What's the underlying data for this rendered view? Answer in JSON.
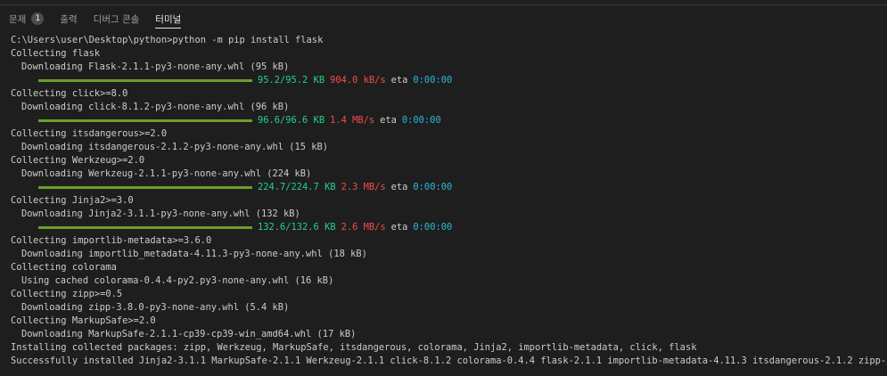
{
  "panel": {
    "tabs": [
      {
        "label": "문제",
        "badge": "1"
      },
      {
        "label": "출력"
      },
      {
        "label": "디버그 콘솔"
      },
      {
        "label": "터미널"
      }
    ]
  },
  "colors": {
    "background": "#1e1e1e",
    "text": "#cccccc",
    "progress_bar": "#6a9f2a",
    "size_text": "#23d18b",
    "speed_text": "#f14c4c",
    "eta_time": "#29b8db"
  },
  "terminal": {
    "lines": [
      "C:\\Users\\user\\Desktop\\python>python -m pip install flask",
      "Collecting flask",
      "Downloading Flask-2.1.1-py3-none-any.whl (95 kB)",
      "Collecting click>=8.0",
      "Downloading click-8.1.2-py3-none-any.whl (96 kB)",
      "Collecting itsdangerous>=2.0",
      "Downloading itsdangerous-2.1.2-py3-none-any.whl (15 kB)",
      "Collecting Werkzeug>=2.0",
      "Downloading Werkzeug-2.1.1-py3-none-any.whl (224 kB)",
      "Collecting Jinja2>=3.0",
      "Downloading Jinja2-3.1.1-py3-none-any.whl (132 kB)",
      "Collecting importlib-metadata>=3.6.0",
      "Downloading importlib_metadata-4.11.3-py3-none-any.whl (18 kB)",
      "Collecting colorama",
      "Using cached colorama-0.4.4-py2.py3-none-any.whl (16 kB)",
      "Collecting zipp>=0.5",
      "Downloading zipp-3.8.0-py3-none-any.whl (5.4 kB)",
      "Collecting MarkupSafe>=2.0",
      "Downloading MarkupSafe-2.1.1-cp39-cp39-win_amd64.whl (17 kB)",
      "Installing collected packages: zipp, Werkzeug, MarkupSafe, itsdangerous, colorama, Jinja2, importlib-metadata, click, flask",
      "Successfully installed Jinja2-3.1.1 MarkupSafe-2.1.1 Werkzeug-2.1.1 click-8.1.2 colorama-0.4.4 flask-2.1.1 importlib-metadata-4.11.3 itsdangerous-2.1.2 zipp-3.8.0"
    ],
    "progress": [
      {
        "size": "95.2/95.2 KB",
        "speed": "904.0 kB/s",
        "eta_label": "eta",
        "eta": "0:00:00",
        "fraction": 1.0
      },
      {
        "size": "96.6/96.6 KB",
        "speed": "1.4 MB/s",
        "eta_label": "eta",
        "eta": "0:00:00",
        "fraction": 1.0
      },
      {
        "size": "224.7/224.7 KB",
        "speed": "2.3 MB/s",
        "eta_label": "eta",
        "eta": "0:00:00",
        "fraction": 1.0
      },
      {
        "size": "132.6/132.6 KB",
        "speed": "2.6 MB/s",
        "eta_label": "eta",
        "eta": "0:00:00",
        "fraction": 1.0
      }
    ]
  }
}
